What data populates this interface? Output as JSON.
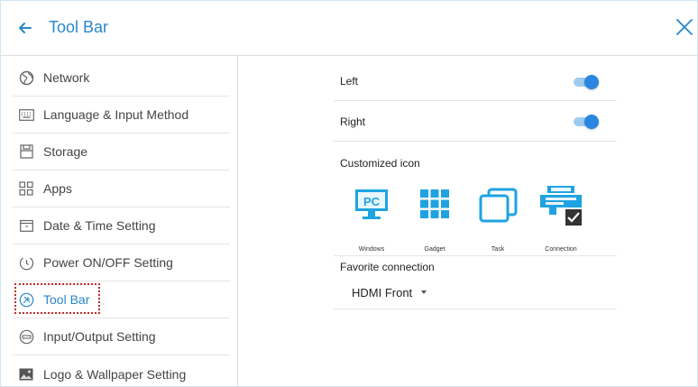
{
  "header": {
    "title": "Tool Bar"
  },
  "sidebar": {
    "items": [
      {
        "label": "Network",
        "icon": "globe-icon"
      },
      {
        "label": "Language & Input Method",
        "icon": "keyboard-icon"
      },
      {
        "label": "Storage",
        "icon": "storage-icon"
      },
      {
        "label": "Apps",
        "icon": "apps-grid-icon"
      },
      {
        "label": "Date & Time Setting",
        "icon": "calendar-icon"
      },
      {
        "label": "Power ON/OFF Setting",
        "icon": "power-clock-icon"
      },
      {
        "label": "Tool Bar",
        "icon": "toolbar-icon",
        "active": true
      },
      {
        "label": "Input/Output Setting",
        "icon": "input-output-icon"
      },
      {
        "label": "Logo & Wallpaper Setting",
        "icon": "wallpaper-icon"
      }
    ]
  },
  "main": {
    "left": {
      "label": "Left",
      "enabled": true
    },
    "right": {
      "label": "Right",
      "enabled": true
    },
    "customized_icon": {
      "label": "Customized icon",
      "items": [
        {
          "caption": "Windows",
          "icon": "pc-monitor-icon"
        },
        {
          "caption": "Gadget",
          "icon": "gadget-grid-icon"
        },
        {
          "caption": "Task",
          "icon": "task-windows-icon"
        },
        {
          "caption": "Connection",
          "icon": "connection-icon",
          "selected": true
        }
      ]
    },
    "favorite_connection": {
      "label": "Favorite connection",
      "value": "HDMI Front"
    }
  },
  "colors": {
    "accent": "#2a86c8",
    "icon_blue": "#1fa3e0",
    "toggle_on": "#2a86e0",
    "highlight_outline": "#c62828"
  }
}
